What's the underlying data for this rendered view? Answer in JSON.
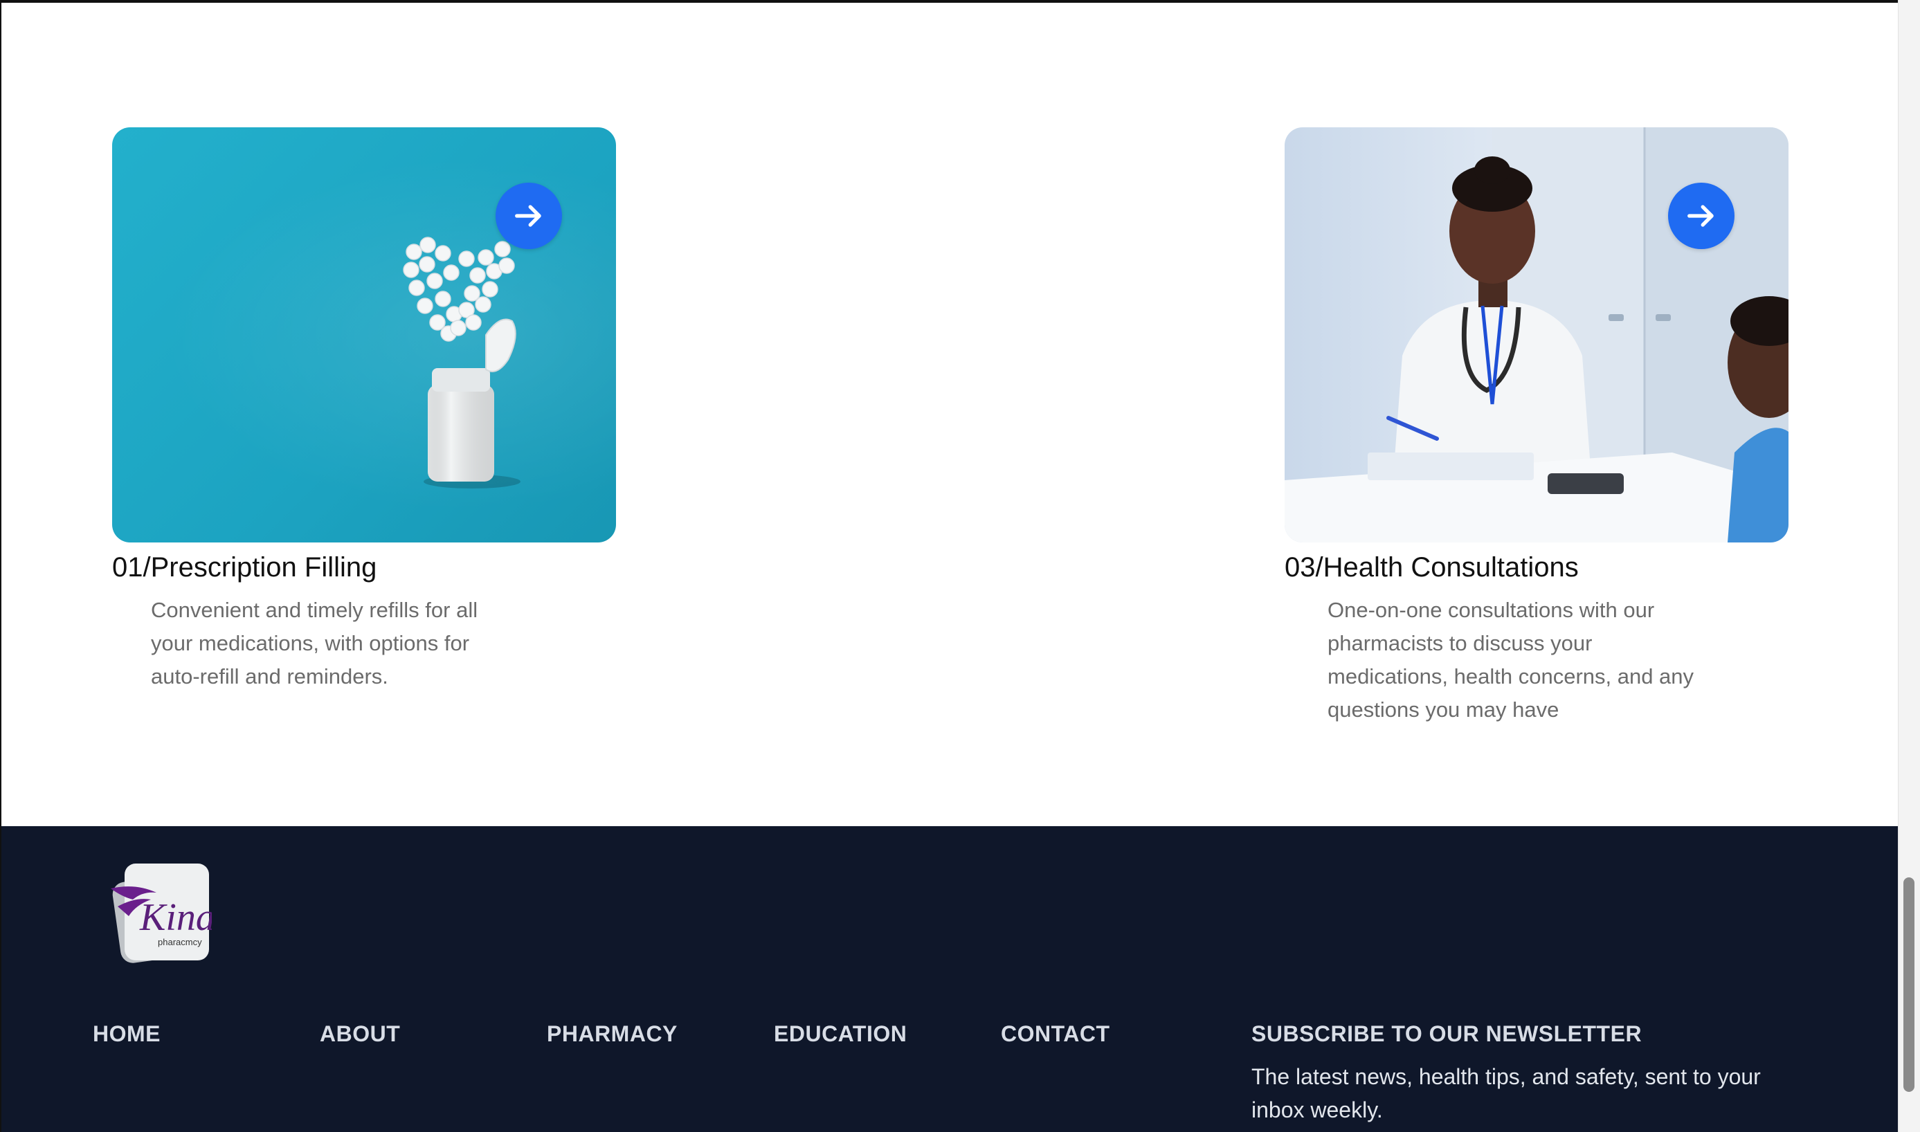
{
  "services": [
    {
      "title": "01/Prescription Filling",
      "description": "Convenient and timely refills for all your medications, with options for auto-refill and reminders.",
      "image_icon": "pill-bottle-heart-image",
      "arrow_icon": "arrow-right-icon"
    },
    {
      "title": "03/Health Consultations",
      "description": "One-on-one consultations with our pharmacists to discuss your medications, health concerns, and any questions you may have",
      "image_icon": "pharmacist-consultation-image",
      "arrow_icon": "arrow-right-icon"
    }
  ],
  "footer": {
    "logo": {
      "brand": "Kina",
      "tagline": "pharacmcy"
    },
    "nav": [
      "HOME",
      "ABOUT",
      "PHARMACY",
      "EDUCATION",
      "CONTACT"
    ],
    "newsletter": {
      "title": "SUBSCRIBE TO OUR NEWSLETTER",
      "text": "The latest news, health tips, and safety, sent to your inbox weekly."
    }
  },
  "colors": {
    "accent": "#1f6bf2",
    "footer_bg": "#0f172a",
    "card_title": "#111111",
    "card_desc": "#6b6b6b",
    "footer_text": "#d8dde6",
    "brand_purple": "#5a1f7a"
  }
}
